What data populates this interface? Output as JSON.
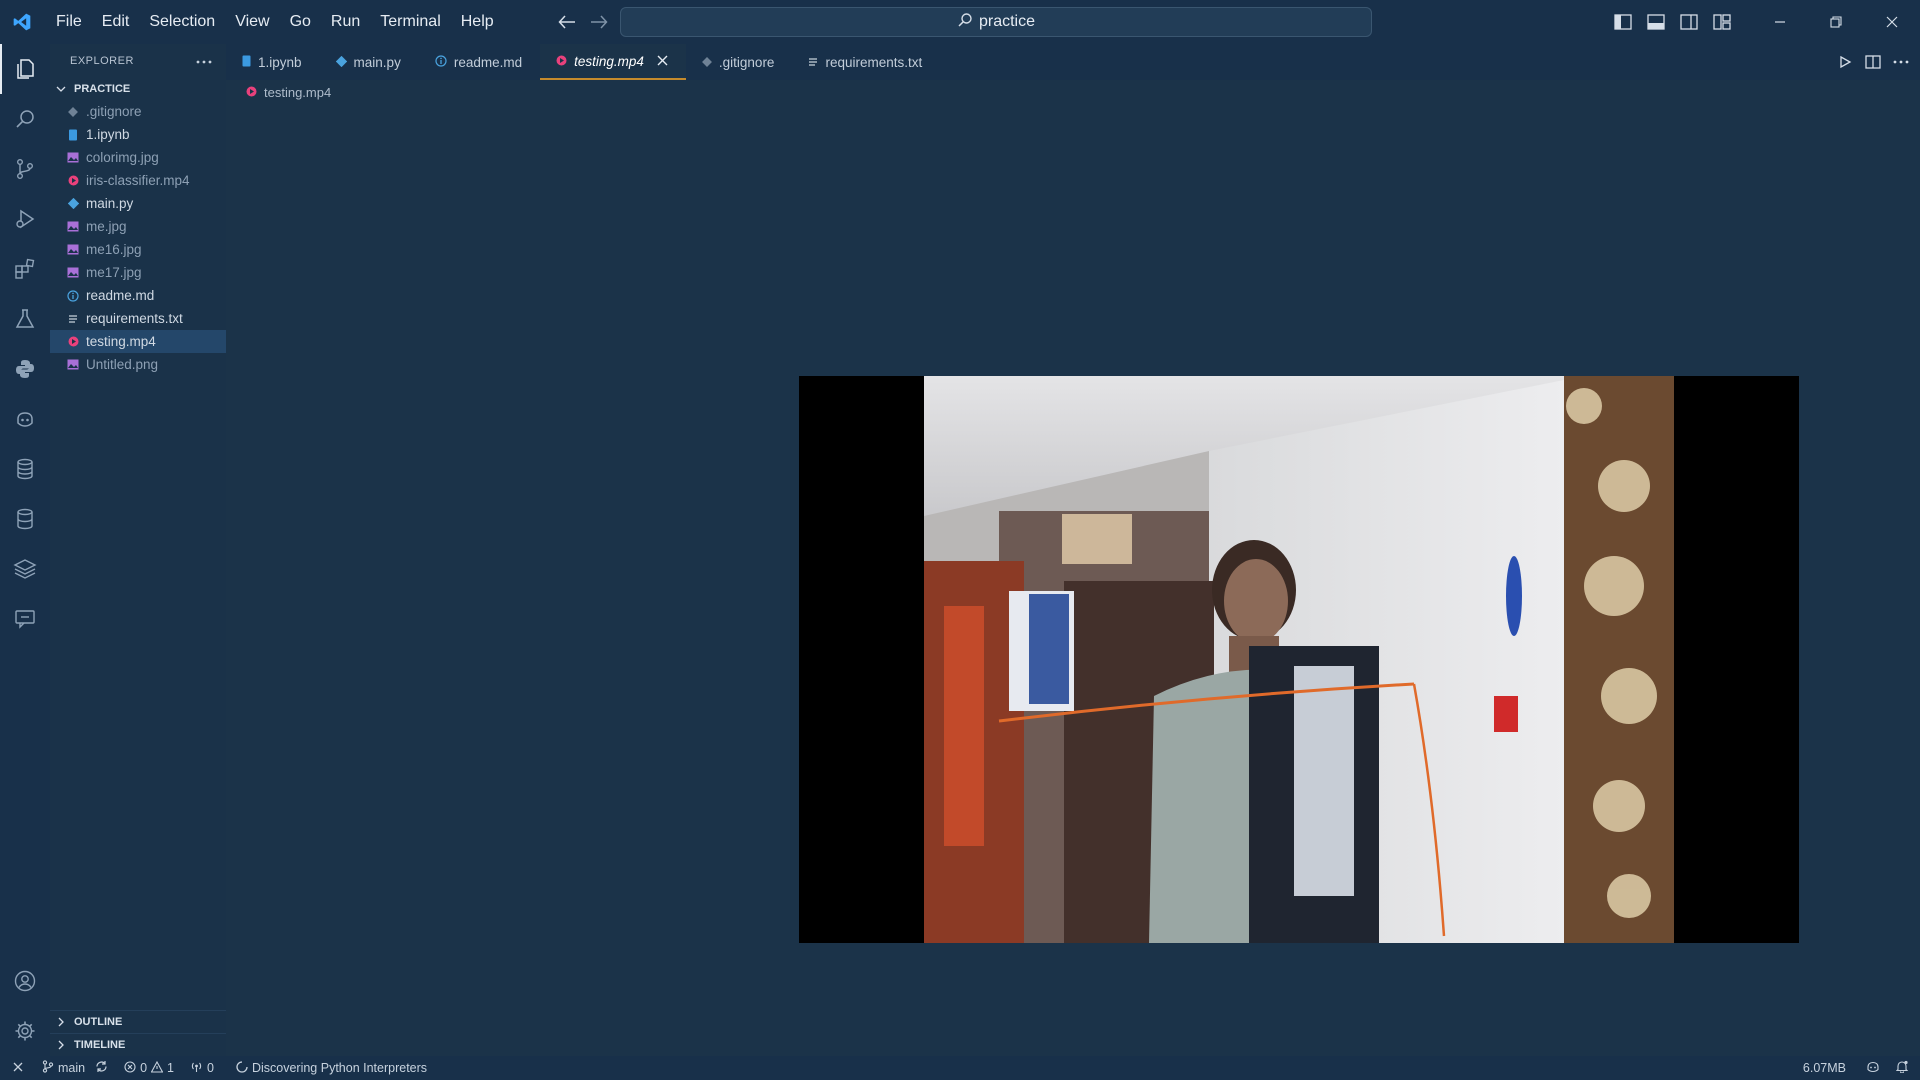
{
  "window": {
    "menu": [
      "File",
      "Edit",
      "Selection",
      "View",
      "Go",
      "Run",
      "Terminal",
      "Help"
    ],
    "search_text": "practice"
  },
  "sidebar": {
    "header": "EXPLORER",
    "folder": "PRACTICE",
    "files": [
      {
        "label": ".gitignore",
        "icon": "git-file-icon",
        "color": "#6f8296"
      },
      {
        "label": "1.ipynb",
        "icon": "notebook-file-icon",
        "color": "#3b9ae1"
      },
      {
        "label": "colorimg.jpg",
        "icon": "image-file-icon",
        "color": "#a970d8"
      },
      {
        "label": "iris-classifier.mp4",
        "icon": "video-file-icon",
        "color": "#e9417c"
      },
      {
        "label": "main.py",
        "icon": "python-file-icon",
        "color": "#4aa3df"
      },
      {
        "label": "me.jpg",
        "icon": "image-file-icon",
        "color": "#a970d8"
      },
      {
        "label": "me16.jpg",
        "icon": "image-file-icon",
        "color": "#a970d8"
      },
      {
        "label": "me17.jpg",
        "icon": "image-file-icon",
        "color": "#a970d8"
      },
      {
        "label": "readme.md",
        "icon": "info-file-icon",
        "color": "#4aa3df"
      },
      {
        "label": "requirements.txt",
        "icon": "text-file-icon",
        "color": "#c8d2dc"
      },
      {
        "label": "testing.mp4",
        "icon": "video-file-icon",
        "color": "#e9417c"
      },
      {
        "label": "Untitled.png",
        "icon": "image-file-icon",
        "color": "#a970d8"
      }
    ],
    "outline": "OUTLINE",
    "timeline": "TIMELINE"
  },
  "tabs": [
    {
      "label": "1.ipynb",
      "icon": "notebook-file-icon",
      "color": "#3b9ae1"
    },
    {
      "label": "main.py",
      "icon": "python-file-icon",
      "color": "#4aa3df"
    },
    {
      "label": "readme.md",
      "icon": "info-file-icon",
      "color": "#4aa3df"
    },
    {
      "label": "testing.mp4",
      "icon": "video-file-icon",
      "color": "#e9417c",
      "active": true
    },
    {
      "label": ".gitignore",
      "icon": "git-file-icon",
      "color": "#6f8296"
    },
    {
      "label": "requirements.txt",
      "icon": "text-file-icon",
      "color": "#c8d2dc"
    }
  ],
  "breadcrumb": "testing.mp4",
  "statusbar": {
    "branch": "main",
    "errors": "0",
    "warnings": "1",
    "ports": "0",
    "message": "Discovering Python Interpreters",
    "memory": "6.07MB"
  },
  "colors": {
    "accent_tab_border": "#c58b2c",
    "background": "#1b3349"
  }
}
